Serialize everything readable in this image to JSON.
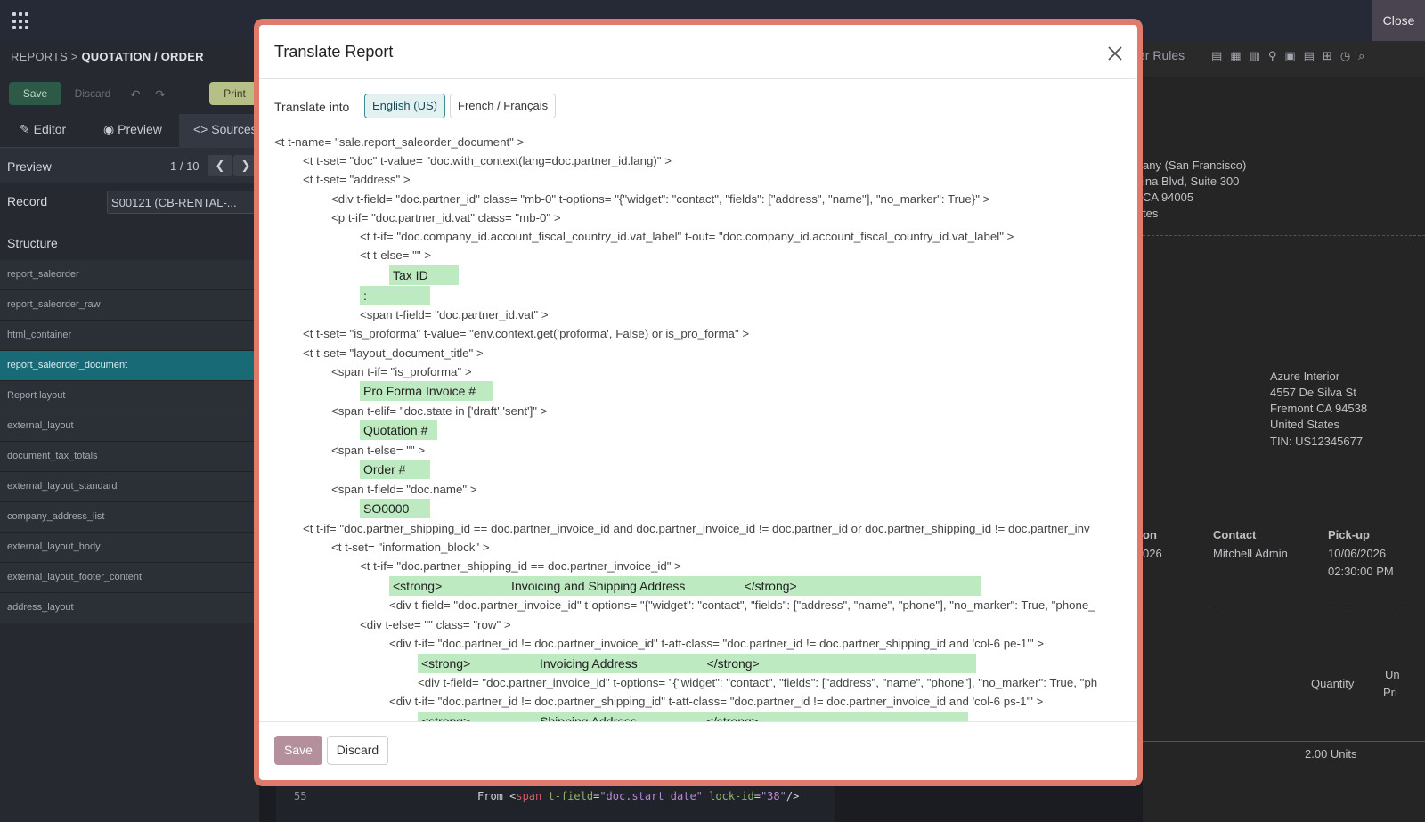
{
  "topbar": {
    "close_label": "Close"
  },
  "breadcrumb": {
    "parent": "REPORTS",
    "separator": ">",
    "current": "QUOTATION / ORDER"
  },
  "toolbar": {
    "save_label": "Save",
    "discard_label": "Discard",
    "print_label": "Print"
  },
  "tabs": [
    {
      "label": "Editor"
    },
    {
      "label": "Preview"
    },
    {
      "label": "Sources"
    }
  ],
  "preview": {
    "label": "Preview",
    "count": "1 / 10"
  },
  "record": {
    "label": "Record",
    "value": "S00121 (CB-RENTAL-..."
  },
  "structure": {
    "label": "Structure",
    "items": [
      {
        "label": "report_saleorder"
      },
      {
        "label": "report_saleorder_raw"
      },
      {
        "label": "html_container"
      },
      {
        "label": "report_saleorder_document"
      },
      {
        "label": "Report layout"
      },
      {
        "label": "external_layout"
      },
      {
        "label": "document_tax_totals"
      },
      {
        "label": "external_layout_standard"
      },
      {
        "label": "company_address_list"
      },
      {
        "label": "external_layout_body"
      },
      {
        "label": "external_layout_footer_content"
      },
      {
        "label": "address_layout"
      }
    ]
  },
  "background_code": {
    "line_number": "55"
  },
  "right_panel": {
    "toolbar_text": "er Rules",
    "company_lines": [
      "any (San Francisco)",
      "ina Blvd, Suite 300",
      "CA 94005",
      "tes"
    ],
    "customer_lines": [
      "Azure Interior",
      "4557 De Silva St",
      "Fremont CA 94538",
      "United States",
      "TIN: US12345677"
    ],
    "info_headers": [
      "on",
      "Contact",
      "Pick-up"
    ],
    "info_values": [
      "026",
      "Mitchell Admin",
      "10/06/2026",
      "02:30:00 PM"
    ],
    "table_headers": [
      "Quantity",
      "Un",
      "Pri"
    ],
    "quantity_value": "2.00 Units"
  },
  "modal": {
    "title": "Translate Report",
    "translate_into_label": "Translate into",
    "languages": [
      {
        "label": "English (US)",
        "active": true
      },
      {
        "label": "French / Français",
        "active": false
      }
    ],
    "save_label": "Save",
    "discard_label": "Discard",
    "code_lines": [
      "<t t-name= \"sale.report_saleorder_document\" >",
      "<t t-set= \"doc\" t-value= \"doc.with_context(lang=doc.partner_id.lang)\" >",
      "<t t-set= \"address\" >",
      "<div t-field= \"doc.partner_id\" class= \"mb-0\" t-options= \"{&quot;widget&quot;: &quot;contact&quot;, &quot;fields&quot;: [&quot;address&quot;, &quot;name&quot;], &quot;no_marker&quot;: True}\" >",
      "<p t-if= \"doc.partner_id.vat\" class= \"mb-0\" >",
      "<t t-if= \"doc.company_id.account_fiscal_country_id.vat_label\" t-out= \"doc.company_id.account_fiscal_country_id.vat_label\" >",
      "<t t-else= \"\" >",
      "Tax ID",
      ":",
      "<span t-field= \"doc.partner_id.vat\" >",
      "<t t-set= \"is_proforma\" t-value= \"env.context.get('proforma', False) or is_pro_forma\" >",
      "<t t-set= \"layout_document_title\" >",
      "<span t-if= \"is_proforma\" >",
      "Pro Forma Invoice #",
      "<span t-elif= \"doc.state in ['draft','sent']\" >",
      "Quotation #",
      "<span t-else= \"\" >",
      "Order #",
      "<span t-field= \"doc.name\" >",
      "SO0000",
      "<t t-if= \"doc.partner_shipping_id == doc.partner_invoice_id and doc.partner_invoice_id != doc.partner_id or doc.partner_shipping_id != doc.partner_inv",
      "<t t-set= \"information_block\" >",
      "<t t-if= \"doc.partner_shipping_id == doc.partner_invoice_id\" >",
      "<strong>                    Invoicing and Shipping Address                 </strong>",
      "<div t-field= \"doc.partner_invoice_id\" t-options= \"{&quot;widget&quot;: &quot;contact&quot;, &quot;fields&quot;: [&quot;address&quot;, &quot;name&quot;, &quot;phone&quot;], &quot;no_marker&quot;: True, &quot;phone_",
      "<div t-else= \"\" class= \"row\" >",
      "<div t-if= \"doc.partner_id != doc.partner_invoice_id\" t-att-class= \"doc.partner_id != doc.partner_shipping_id and 'col-6 pe-1'\" >",
      "<strong>                    Invoicing Address                    </strong>",
      "<div t-field= \"doc.partner_invoice_id\" t-options= \"{&quot;widget&quot;: &quot;contact&quot;, &quot;fields&quot;: [&quot;address&quot;, &quot;name&quot;, &quot;phone&quot;], &quot;no_marker&quot;: True, &quot;ph",
      "<div t-if= \"doc.partner_id != doc.partner_shipping_id\" t-att-class= \"doc.partner_id != doc.partner_invoice_id and 'col-6 ps-1'\" >",
      "<strong>                    Shipping Address                    </strong>"
    ]
  }
}
